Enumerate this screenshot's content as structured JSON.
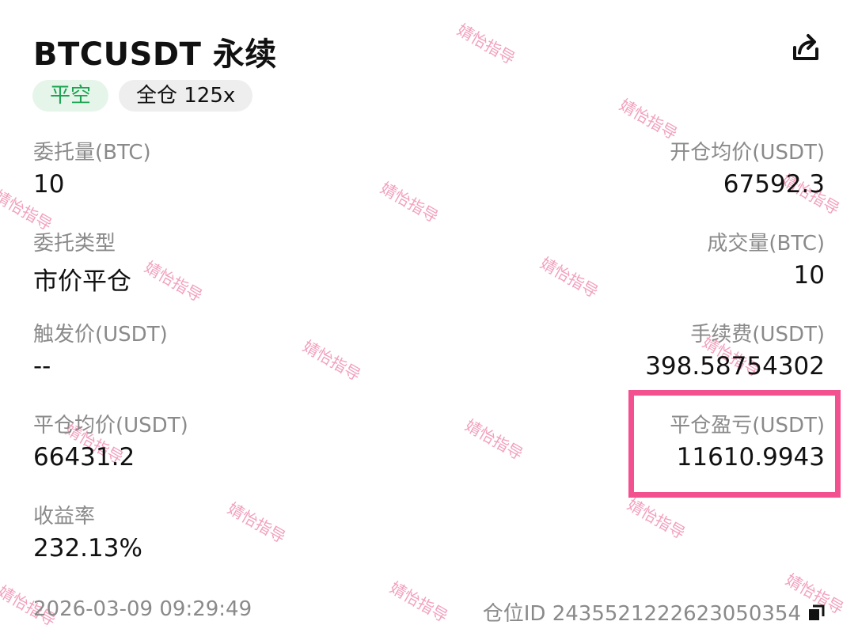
{
  "header": {
    "title": "BTCUSDT 永续",
    "tag_side": "平空",
    "tag_margin": "全仓 125x"
  },
  "watermark": "婧怡指导",
  "fields": {
    "order_qty_label": "委托量(BTC)",
    "order_qty_value": "10",
    "open_avg_label": "开仓均价(USDT)",
    "open_avg_value": "67592.3",
    "order_type_label": "委托类型",
    "order_type_value": "市价平仓",
    "filled_qty_label": "成交量(BTC)",
    "filled_qty_value": "10",
    "trigger_price_label": "触发价(USDT)",
    "trigger_price_value": "--",
    "fee_label": "手续费(USDT)",
    "fee_value": "398.58754302",
    "close_avg_label": "平仓均价(USDT)",
    "close_avg_value": "66431.2",
    "close_pnl_label": "平仓盈亏(USDT)",
    "close_pnl_value": "11610.9943",
    "roi_label": "收益率",
    "roi_value": "232.13%"
  },
  "footer": {
    "timestamp": "2026-03-09 09:29:49",
    "position_id": "仓位ID 2435521222623050354"
  },
  "colors": {
    "short_tag_text": "#1aa350",
    "short_tag_bg": "#e6f5ea",
    "highlight": "#f2508f"
  },
  "icons": [
    "share-icon",
    "copy-icon"
  ]
}
